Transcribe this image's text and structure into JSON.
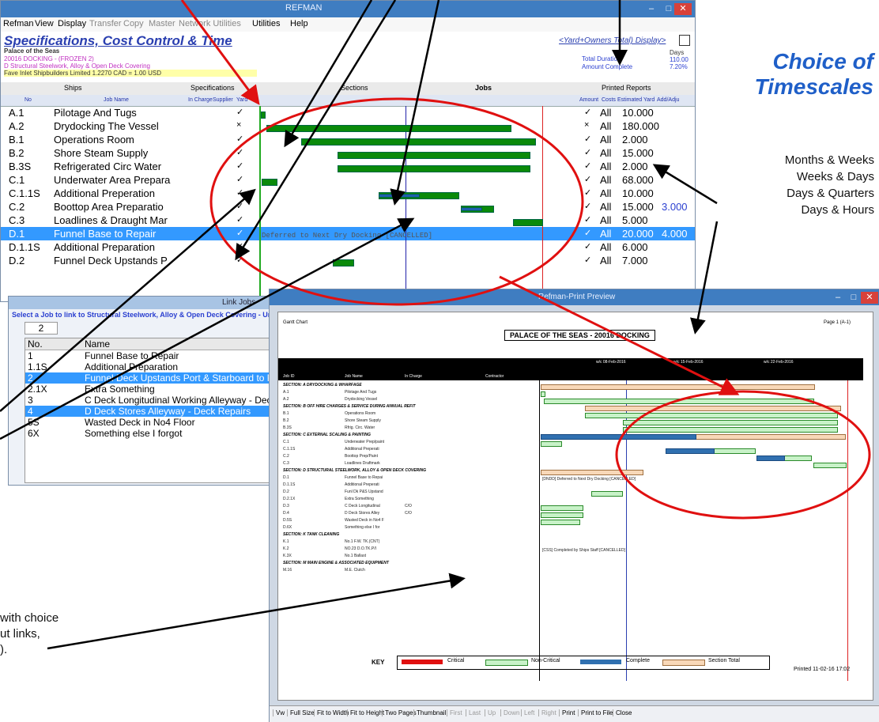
{
  "main_window": {
    "title": "REFMAN",
    "menu": [
      "Refman",
      "View",
      "Display",
      "Transfer",
      "Copy",
      "Master",
      "Network Utilities",
      "Utilities",
      "Help"
    ],
    "app_title": "Specifications, Cost Control & Time",
    "display_mode": "<Yard+Owners Total) Display>",
    "ship_name": "Palace of the Seas",
    "docking_line": "20016 DOCKING - (FROZEN 2)",
    "section_line": "D Structural Steelwork, Alloy & Open Deck Covering",
    "yard_line": "Fave Inlet Shipbuilders Limited 1.2270 CAD = 1.00 USD",
    "summary_labels": [
      "Total Duration",
      "Amount Complete"
    ],
    "summary_days_label": "Days",
    "summary_values": [
      "110.00",
      "7.20%"
    ],
    "tabs": [
      "Ships",
      "Specifications",
      "Sections",
      "Jobs",
      "Printed Reports"
    ],
    "columns": [
      "No",
      "Job Name",
      "In Charge",
      "Supplier",
      "Yard",
      "Amount",
      "Costs",
      "Estimated Yard",
      "Add/Adju"
    ],
    "rows": [
      {
        "no": "A.1",
        "name": "Pilotage And Tugs",
        "mark": "✓",
        "all": "All",
        "val": "10.000",
        "extra": ""
      },
      {
        "no": "A.2",
        "name": "Drydocking The Vessel",
        "mark": "×",
        "all": "All",
        "val": "180.000",
        "extra": ""
      },
      {
        "no": "B.1",
        "name": "Operations Room",
        "mark": "✓",
        "all": "All",
        "val": "2.000",
        "extra": ""
      },
      {
        "no": "B.2",
        "name": "Shore Steam Supply",
        "mark": "✓",
        "all": "All",
        "val": "15.000",
        "extra": ""
      },
      {
        "no": "B.3S",
        "name": "Refrigerated Circ Water",
        "mark": "✓",
        "all": "All",
        "val": "2.000",
        "extra": ""
      },
      {
        "no": "C.1",
        "name": "Underwater Area Prepara",
        "mark": "✓",
        "all": "All",
        "val": "68.000",
        "extra": ""
      },
      {
        "no": "C.1.1S",
        "name": "Additional Preperation",
        "mark": "✓",
        "all": "All",
        "val": "10.000",
        "extra": ""
      },
      {
        "no": "C.2",
        "name": "Boottop Area Preparatio",
        "mark": "✓",
        "all": "All",
        "val": "15.000",
        "extra": "3.000"
      },
      {
        "no": "C.3",
        "name": "Loadlines & Draught Mar",
        "mark": "✓",
        "all": "All",
        "val": "5.000",
        "extra": ""
      },
      {
        "no": "D.1",
        "name": "Funnel Base to Repair",
        "mark": "✓",
        "all": "All",
        "val": "20.000",
        "extra": "4.000"
      },
      {
        "no": "D.1.1S",
        "name": "Additional Preparation",
        "mark": "✓",
        "all": "All",
        "val": "6.000",
        "extra": ""
      },
      {
        "no": "D.2",
        "name": "Funnel Deck Upstands P",
        "mark": "✓",
        "all": "All",
        "val": "7.000",
        "extra": ""
      }
    ],
    "deferred_note": "Deferred to Next Dry Docking [CANCELLED]"
  },
  "link_dialog": {
    "title": "Link Jobs",
    "prompt": "Select a Job to link to Structural Steelwork, Alloy & Open Deck Covering - Under",
    "spin_value": "2",
    "columns": [
      "No.",
      "Name"
    ],
    "items": [
      {
        "no": "1",
        "name": "Funnel Base to Repair"
      },
      {
        "no": "1.1S",
        "name": "Additional Preparation"
      },
      {
        "no": "2",
        "name": "Funnel Deck Upstands Port & Starboard to Repa"
      },
      {
        "no": "2.1X",
        "name": "Extra Something"
      },
      {
        "no": "3",
        "name": "C Deck Longitudinal Working Alleyway - Deck Re"
      },
      {
        "no": "4",
        "name": "D Deck Stores Alleyway - Deck Repairs"
      },
      {
        "no": "5S",
        "name": "Wasted Deck in No4 Floor"
      },
      {
        "no": "6X",
        "name": "Something else I forgot"
      }
    ]
  },
  "print_preview": {
    "title": "Refman-Print Preview",
    "gantt_label": "Gantt Chart",
    "page_title": "PALACE OF THE SEAS - 20016 DOCKING",
    "page_number": "Page 1  (A-1)",
    "weeks": [
      "w/c 08-Feb-2016",
      "w/c 15-Feb-2016",
      "w/c 22-Feb-2016"
    ],
    "col_headers": [
      "Job ID",
      "Job Name",
      "In Charge",
      "Contractor"
    ],
    "lines": [
      {
        "type": "sec",
        "text": "SECTION: A DRYDOCKING & WHARFAGE"
      },
      {
        "type": "job",
        "id": "A.1",
        "name": "Pilotage And Tugs",
        "who": ""
      },
      {
        "type": "job",
        "id": "A.2",
        "name": "Drydocking Vessel",
        "who": ""
      },
      {
        "type": "sec",
        "text": "SECTION: B OFF HIRE CHARGES & SERVICE DURING ANNUAL REFIT"
      },
      {
        "type": "job",
        "id": "B.1",
        "name": "Operations Room",
        "who": ""
      },
      {
        "type": "job",
        "id": "B.2",
        "name": "Shore Steam Supply",
        "who": ""
      },
      {
        "type": "job",
        "id": "B.3S",
        "name": "Rfrig. Circ. Water",
        "who": ""
      },
      {
        "type": "sec",
        "text": "SECTION: C EXTERNAL SCALING & PAINTING"
      },
      {
        "type": "job",
        "id": "C.1",
        "name": "Underwater Prep/paint",
        "who": ""
      },
      {
        "type": "job",
        "id": "C.1.1S",
        "name": "Additional Preperati",
        "who": ""
      },
      {
        "type": "job",
        "id": "C.2",
        "name": "Boottop Prep/Paint",
        "who": ""
      },
      {
        "type": "job",
        "id": "C.3",
        "name": "Loadlines Draftmark",
        "who": ""
      },
      {
        "type": "sec",
        "text": "SECTION: D STRUCTURAL STEELWORK, ALLOY & OPEN DECK COVERING"
      },
      {
        "type": "job",
        "id": "D.1",
        "name": "Funnel Base to Repai",
        "who": ""
      },
      {
        "type": "job",
        "id": "D.1.1S",
        "name": "Additional Preperati",
        "who": ""
      },
      {
        "type": "job",
        "id": "D.2",
        "name": "Funl Dk P&S Upstand",
        "who": ""
      },
      {
        "type": "job",
        "id": "D.2.1X",
        "name": "Extra Something",
        "who": ""
      },
      {
        "type": "job",
        "id": "D.3",
        "name": "C Deck Longitudinal",
        "who": "C/O"
      },
      {
        "type": "job",
        "id": "D.4",
        "name": "D Deck Stores Alley",
        "who": "C/O"
      },
      {
        "type": "job",
        "id": "D.5S",
        "name": "Wasted Deck in No4 F",
        "who": ""
      },
      {
        "type": "job",
        "id": "D.6X",
        "name": "Something else I for",
        "who": ""
      },
      {
        "type": "sec",
        "text": "SECTION: K TANK CLEANING"
      },
      {
        "type": "job",
        "id": "K.1",
        "name": "No.1 F.W. TK.(CNT)",
        "who": ""
      },
      {
        "type": "job",
        "id": "K.2",
        "name": "NO.23 D.O.TK.P/I",
        "who": ""
      },
      {
        "type": "job",
        "id": "K.3X",
        "name": "No.1 Ballast",
        "who": ""
      },
      {
        "type": "sec",
        "text": "SECTION: M MAIN ENGINE & ASSOCIATED EQUIPMENT"
      },
      {
        "type": "job",
        "id": "M.16",
        "name": "M.E. Clutch",
        "who": ""
      }
    ],
    "note_d1": "[DNDD] Deferred to Next Dry Docking [CANCELLED]",
    "note_k2": "[CSS] Completed by Ships Staff [CANCELLED]",
    "key_label": "KEY",
    "key_items": [
      "Critical",
      "Non-Critical",
      "Complete",
      "Section Total"
    ],
    "key_colors": [
      "#e01010",
      "#c8f2c8",
      "#3070b0",
      "#f8d8b8"
    ],
    "printed": "Printed 11-02-16  17:02",
    "toolbar": [
      "Vw",
      "Full Size",
      "Fit to Width",
      "Fit to Height",
      "Two Pages",
      "Thumbnail",
      "First",
      "Last",
      "Up",
      "Down",
      "Left",
      "Right",
      "Print",
      "Print to File",
      "Close"
    ]
  },
  "annotations": {
    "heading_line1": "Choice of",
    "heading_line2": "Timescales",
    "timescales": [
      "Months & Weeks",
      "Weeks & Days",
      "Days & Quarters",
      "Days & Hours"
    ],
    "footer_lines": [
      "with choice",
      "ut links,",
      ")."
    ]
  }
}
